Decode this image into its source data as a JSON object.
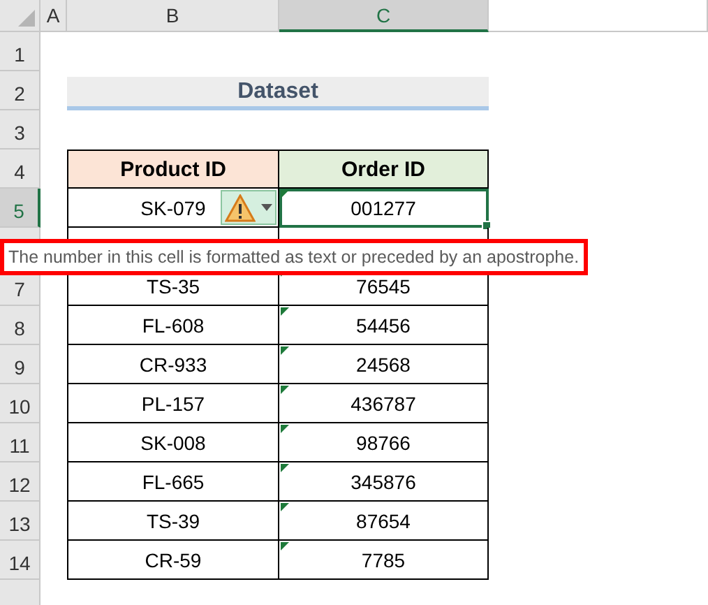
{
  "columns": [
    {
      "label": "A",
      "selected": false
    },
    {
      "label": "B",
      "selected": false
    },
    {
      "label": "C",
      "selected": true
    }
  ],
  "top_rows": [
    {
      "number": "1",
      "selected": false
    },
    {
      "number": "2",
      "selected": false
    },
    {
      "number": "3",
      "selected": false
    },
    {
      "number": "4",
      "selected": false
    }
  ],
  "title": "Dataset",
  "table": {
    "headers": [
      "Product ID",
      "Order ID"
    ],
    "rows": [
      {
        "number": "5",
        "product_id": "SK-079",
        "order_id": "001277",
        "error_flag": true,
        "selected": true,
        "smart_tag": true
      },
      {
        "number": "7",
        "product_id": "TS-35",
        "order_id": "76545",
        "error_flag": true,
        "selected": false,
        "smart_tag": false
      },
      {
        "number": "8",
        "product_id": "FL-608",
        "order_id": "54456",
        "error_flag": true,
        "selected": false,
        "smart_tag": false
      },
      {
        "number": "9",
        "product_id": "CR-933",
        "order_id": "24568",
        "error_flag": true,
        "selected": false,
        "smart_tag": false
      },
      {
        "number": "10",
        "product_id": "PL-157",
        "order_id": "436787",
        "error_flag": true,
        "selected": false,
        "smart_tag": false
      },
      {
        "number": "11",
        "product_id": "SK-008",
        "order_id": "98766",
        "error_flag": true,
        "selected": false,
        "smart_tag": false
      },
      {
        "number": "12",
        "product_id": "FL-665",
        "order_id": "345876",
        "error_flag": true,
        "selected": false,
        "smart_tag": false
      },
      {
        "number": "13",
        "product_id": "TS-39",
        "order_id": "87654",
        "error_flag": true,
        "selected": false,
        "smart_tag": false
      },
      {
        "number": "14",
        "product_id": "CR-59",
        "order_id": "7785",
        "error_flag": true,
        "selected": false,
        "smart_tag": false
      }
    ]
  },
  "error_tooltip": {
    "text": "The number in this cell is formatted as text or preceded by an apostrophe."
  }
}
